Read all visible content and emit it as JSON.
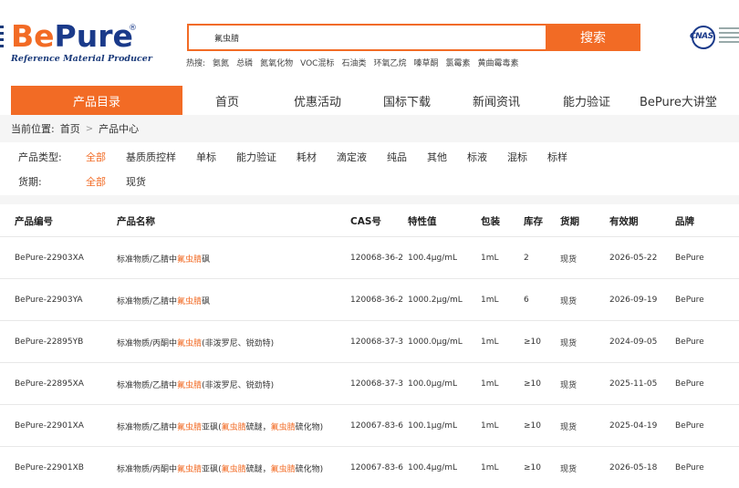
{
  "header": {
    "logo": {
      "be": "Be",
      "pure": "Pure",
      "reg": "®",
      "subtitle": "Reference Material Producer"
    },
    "search": {
      "value": "氟虫腈",
      "button": "搜索"
    },
    "hot_label": "热搜:",
    "hot_terms": [
      "氨氮",
      "总磷",
      "氮氧化物",
      "VOC混标",
      "石油类",
      "环氧乙烷",
      "嗪草酮",
      "氯霉素",
      "黄曲霉毒素"
    ],
    "cnas": {
      "text": "CNAS"
    }
  },
  "nav": {
    "category": "产品目录",
    "items": [
      "首页",
      "优惠活动",
      "国标下载",
      "新闻资讯",
      "能力验证",
      "BePure大讲堂"
    ]
  },
  "breadcrumb": {
    "label": "当前位置:",
    "home": "首页",
    "sep": ">",
    "current": "产品中心"
  },
  "filters": {
    "type_label": "产品类型:",
    "type_options": [
      "全部",
      "基质质控样",
      "单标",
      "能力验证",
      "耗材",
      "滴定液",
      "纯品",
      "其他",
      "标液",
      "混标",
      "标样"
    ],
    "stock_label": "货期:",
    "stock_options": [
      "全部",
      "现货"
    ]
  },
  "table": {
    "headers": [
      "产品编号",
      "产品名称",
      "CAS号",
      "特性值",
      "包装",
      "库存",
      "货期",
      "有效期",
      "品牌"
    ],
    "rows": [
      {
        "code": "BePure-22903XA",
        "name": [
          {
            "t": "标准物质/乙腈中"
          },
          {
            "t": "氟虫腈",
            "h": true
          },
          {
            "t": "砜"
          }
        ],
        "cas": "120068-36-2",
        "value": "100.4μg/mL",
        "pack": "1mL",
        "stock": "2",
        "lead": "现货",
        "expiry": "2026-05-22",
        "brand": "BePure"
      },
      {
        "code": "BePure-22903YA",
        "name": [
          {
            "t": "标准物质/乙腈中"
          },
          {
            "t": "氟虫腈",
            "h": true
          },
          {
            "t": "砜"
          }
        ],
        "cas": "120068-36-2",
        "value": "1000.2μg/mL",
        "pack": "1mL",
        "stock": "6",
        "lead": "现货",
        "expiry": "2026-09-19",
        "brand": "BePure"
      },
      {
        "code": "BePure-22895YB",
        "name": [
          {
            "t": "标准物质/丙酮中"
          },
          {
            "t": "氟虫腈",
            "h": true
          },
          {
            "t": "(非泼罗尼、锐劲特)"
          }
        ],
        "cas": "120068-37-3",
        "value": "1000.0μg/mL",
        "pack": "1mL",
        "stock": "≥10",
        "lead": "现货",
        "expiry": "2024-09-05",
        "brand": "BePure"
      },
      {
        "code": "BePure-22895XA",
        "name": [
          {
            "t": "标准物质/乙腈中"
          },
          {
            "t": "氟虫腈",
            "h": true
          },
          {
            "t": "(非泼罗尼、锐劲特)"
          }
        ],
        "cas": "120068-37-3",
        "value": "100.0μg/mL",
        "pack": "1mL",
        "stock": "≥10",
        "lead": "现货",
        "expiry": "2025-11-05",
        "brand": "BePure"
      },
      {
        "code": "BePure-22901XA",
        "name": [
          {
            "t": "标准物质/乙腈中"
          },
          {
            "t": "氟虫腈",
            "h": true
          },
          {
            "t": "亚砜("
          },
          {
            "t": "氟虫腈",
            "h": true
          },
          {
            "t": "硫醚，"
          },
          {
            "t": "氟虫腈",
            "h": true
          },
          {
            "t": "硫化物)"
          }
        ],
        "cas": "120067-83-6",
        "value": "100.1μg/mL",
        "pack": "1mL",
        "stock": "≥10",
        "lead": "现货",
        "expiry": "2025-04-19",
        "brand": "BePure"
      },
      {
        "code": "BePure-22901XB",
        "name": [
          {
            "t": "标准物质/丙酮中"
          },
          {
            "t": "氟虫腈",
            "h": true
          },
          {
            "t": "亚砜("
          },
          {
            "t": "氟虫腈",
            "h": true
          },
          {
            "t": "硫醚，"
          },
          {
            "t": "氟虫腈",
            "h": true
          },
          {
            "t": "硫化物)"
          }
        ],
        "cas": "120067-83-6",
        "value": "100.4μg/mL",
        "pack": "1mL",
        "stock": "≥10",
        "lead": "现货",
        "expiry": "2026-05-18",
        "brand": "BePure"
      }
    ]
  },
  "colors": {
    "accent": "#f26b25",
    "brand_blue": "#1a3a8a"
  }
}
